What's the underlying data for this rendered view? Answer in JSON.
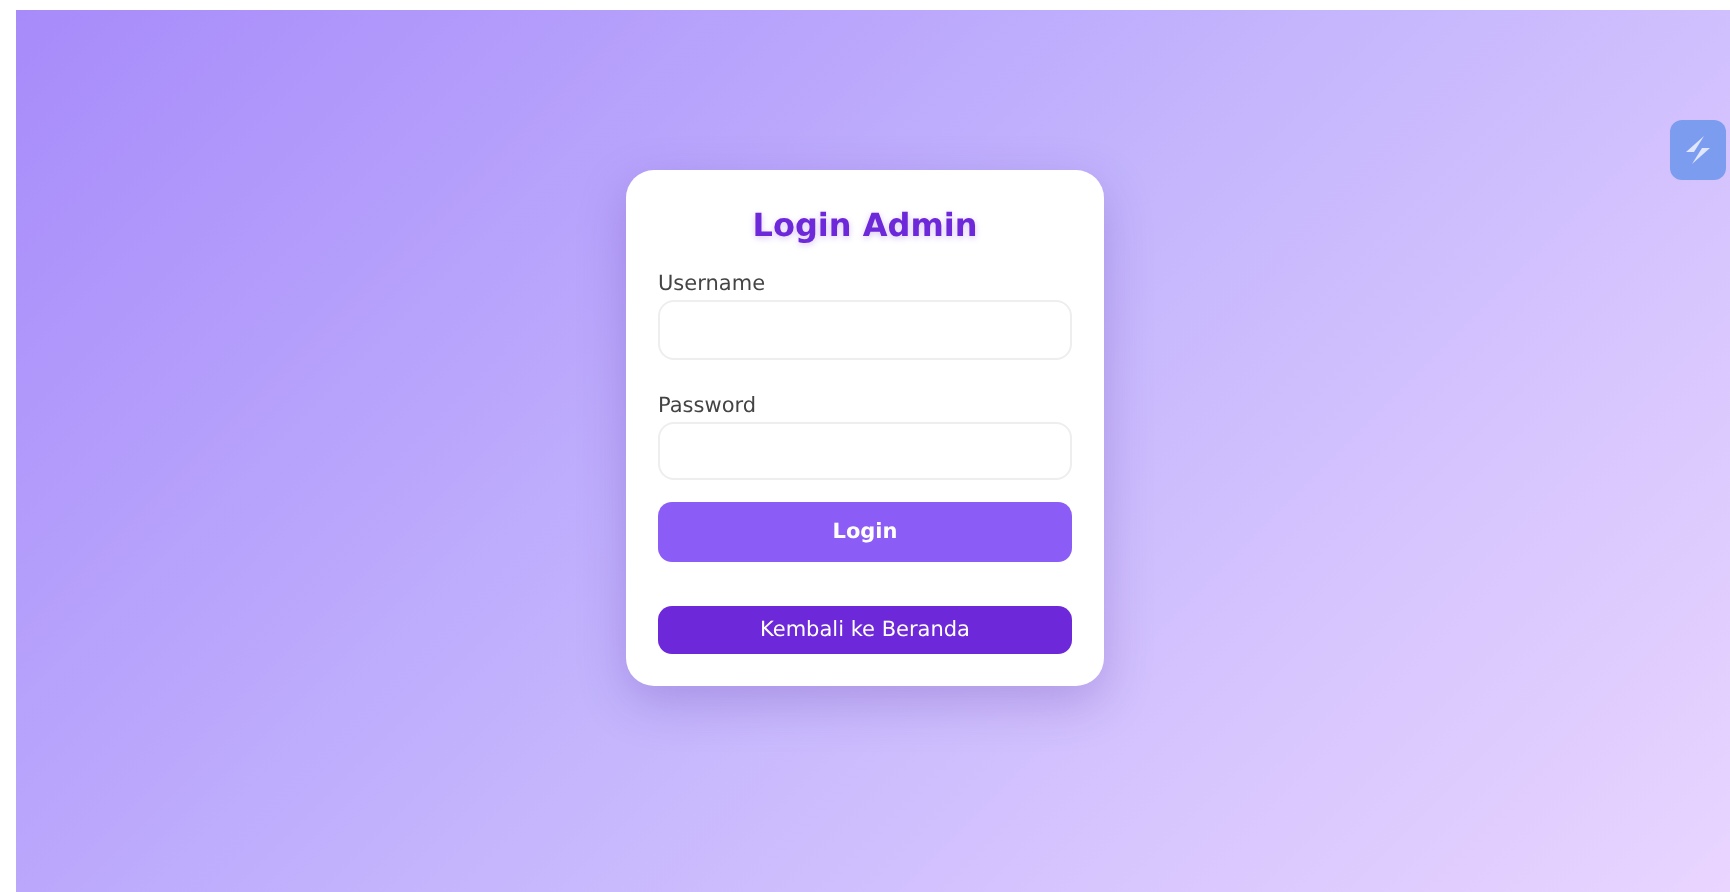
{
  "title": "Login Admin",
  "fields": [
    {
      "label": "Username"
    },
    {
      "label": "Password"
    }
  ],
  "buttons": [
    {
      "label": "Login",
      "kind": "primary"
    },
    {
      "label": "Kembali ke Beranda",
      "kind": "secondary"
    }
  ]
}
